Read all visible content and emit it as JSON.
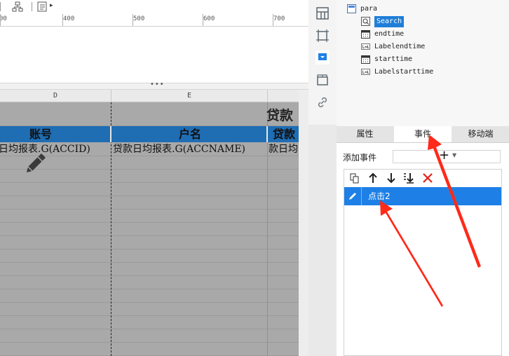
{
  "ruler": {
    "labels": [
      "00",
      "400",
      "500",
      "600",
      "700"
    ]
  },
  "splitter": {
    "grip": "•••"
  },
  "columns": {
    "d": "D",
    "e": "E"
  },
  "report": {
    "title_fragment": "贷款",
    "headers": [
      "账号",
      "户名",
      "贷款"
    ],
    "cells": [
      "日均报表.G(ACCID)",
      "贷款日均报表.G(ACCNAME)",
      "款日均"
    ]
  },
  "tree": {
    "items": [
      {
        "label": "para",
        "icon": "form-icon"
      },
      {
        "label": "Search",
        "icon": "search-widget-icon",
        "selected": true
      },
      {
        "label": "endtime",
        "icon": "calendar-icon"
      },
      {
        "label": "Labelendtime",
        "icon": "label-icon"
      },
      {
        "label": "starttime",
        "icon": "calendar-icon"
      },
      {
        "label": "Labelstarttime",
        "icon": "label-icon"
      }
    ]
  },
  "tabs": [
    "属性",
    "事件",
    "移动端"
  ],
  "events": {
    "add_label": "添加事件",
    "add_symbol": "+",
    "items": [
      "点击2"
    ]
  },
  "colors": {
    "accent": "#1e80e6",
    "report_header": "#1f6db3",
    "annotation_arrow": "#ff2a1a"
  }
}
